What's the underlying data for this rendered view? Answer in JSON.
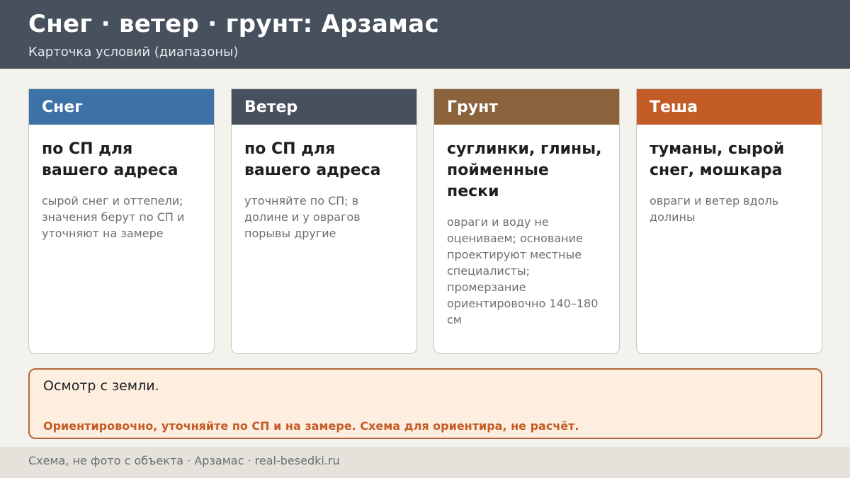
{
  "header": {
    "title": "Снег · ветер · грунт: Арзамас",
    "subtitle": "Карточка условий (диапазоны)"
  },
  "cards": [
    {
      "heading": "Снег",
      "value": "по СП для вашего адреса",
      "note": "сырой снег и оттепели; значения берут по СП и уточняют на замере",
      "color": "#3c72a6"
    },
    {
      "heading": "Ветер",
      "value": "по СП для вашего адреса",
      "note": "уточняйте по СП; в долине и у оврагов порывы другие",
      "color": "#47515e"
    },
    {
      "heading": "Грунт",
      "value": "суглинки, глины, пойменные пески",
      "note": "овраги и воду не оцениваем; основание проектируют местные специалисты; промерзание ориентировочно 140–180 см",
      "color": "#8a633d"
    },
    {
      "heading": "Теша",
      "value": "туманы, сырой снег, мошкара",
      "note": "овраги и ветер вдоль долины",
      "color": "#c35c26"
    }
  ],
  "notice": {
    "text": "Осмотр с земли.",
    "warning": "Ориентировочно, уточняйте по СП и на замере. Схема для ориентира, не расчёт."
  },
  "footer": {
    "text": "Схема, не фото с объекта  ·  Арзамас  ·  real-besedki.ru"
  }
}
